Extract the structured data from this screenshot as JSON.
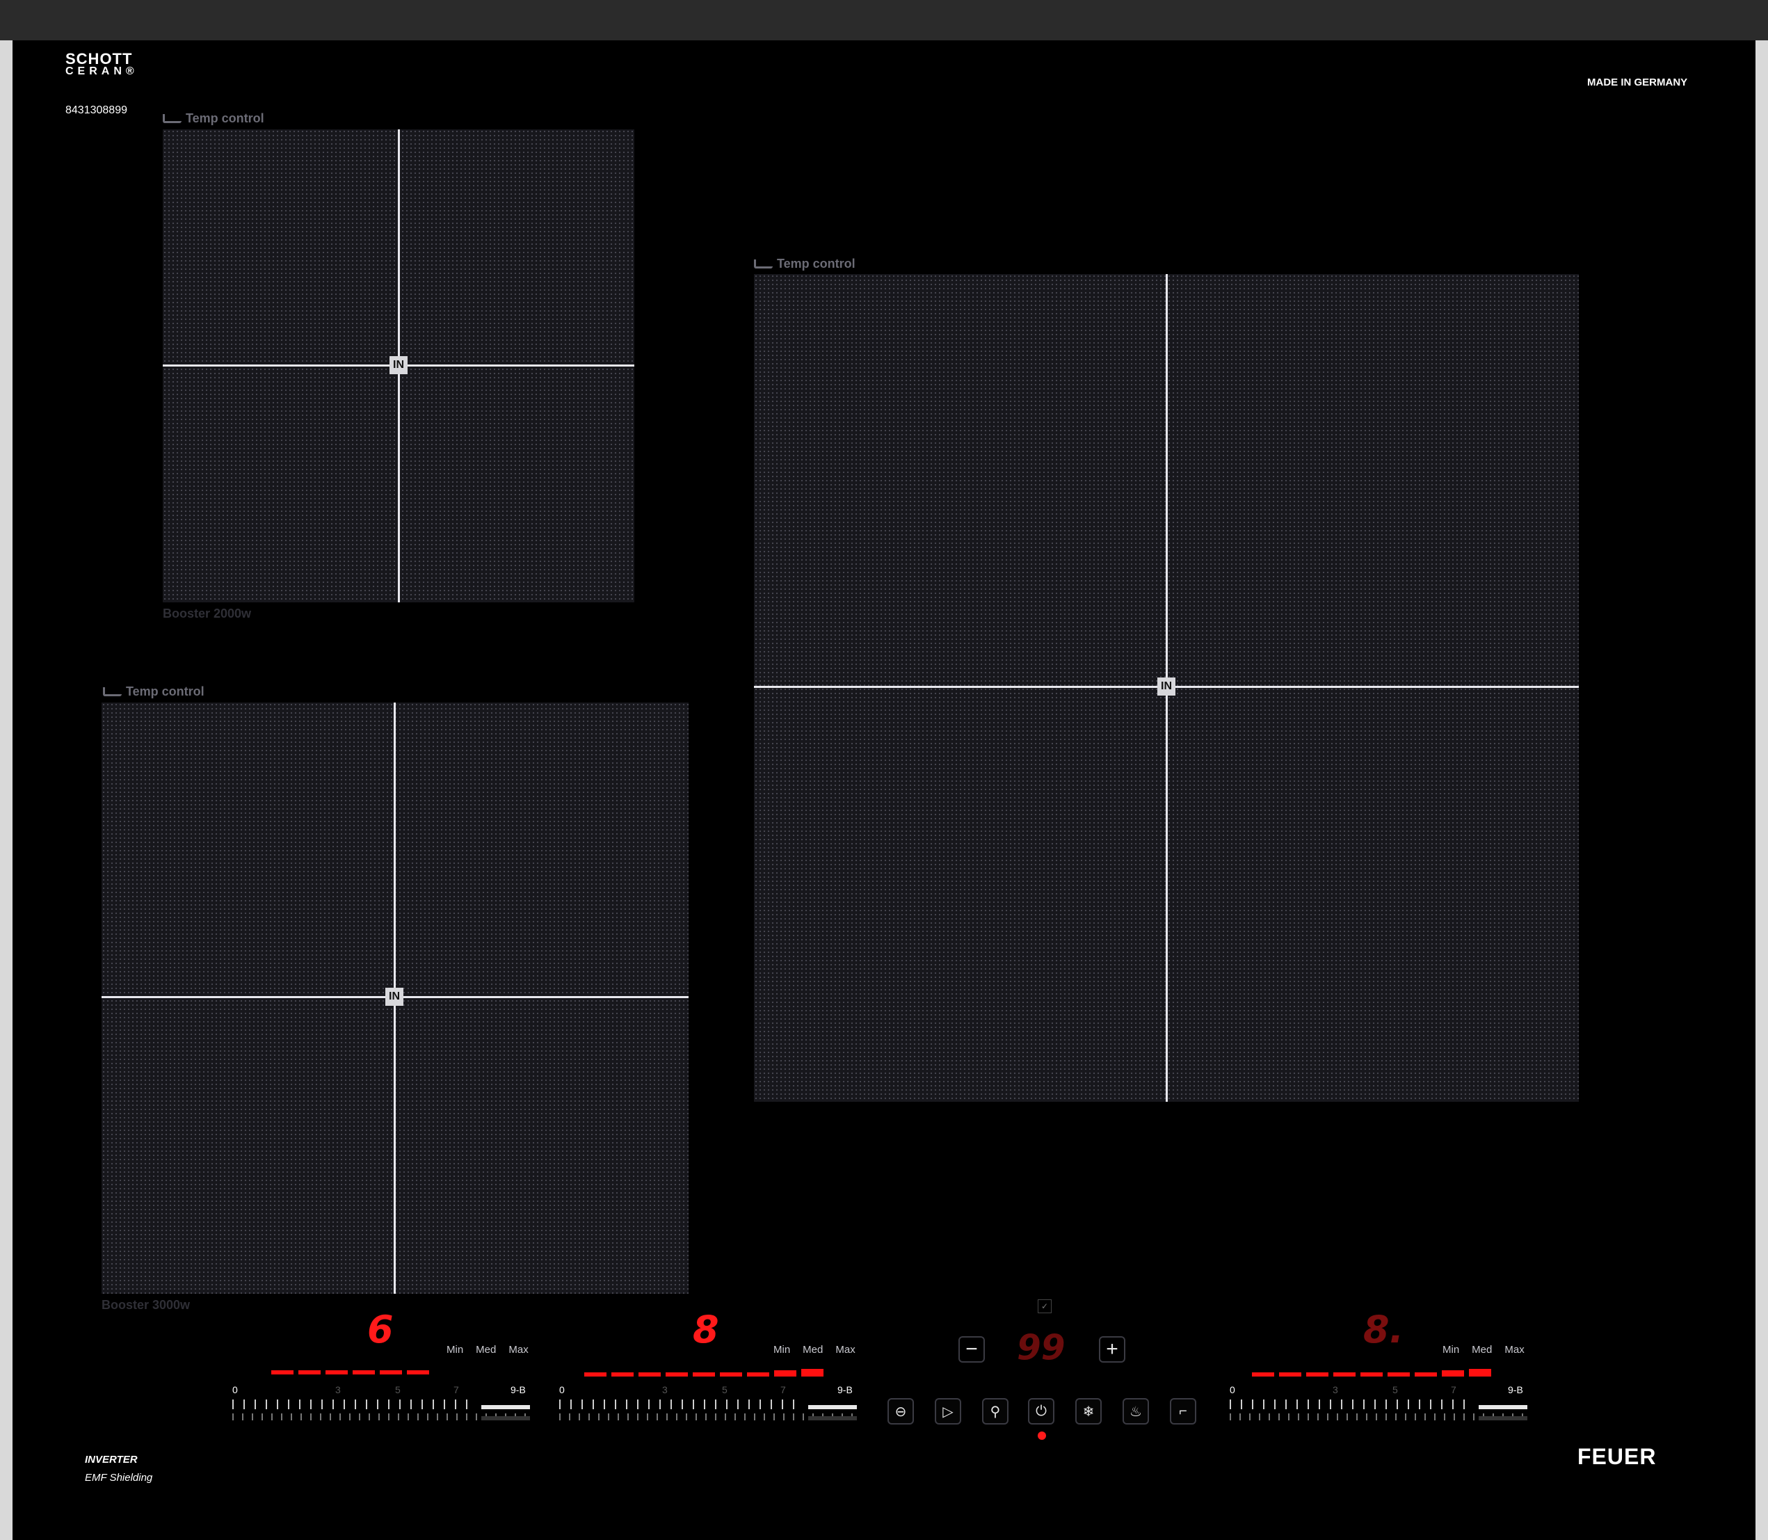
{
  "header": {
    "brand_line1": "SCHOTT",
    "brand_line2": "CERAN®",
    "serial": "8431308899",
    "origin": "MADE IN GERMANY"
  },
  "zones": [
    {
      "label": "Temp control",
      "footer": "Booster 2000w",
      "badge": "IN"
    },
    {
      "label": "Temp control",
      "footer": "",
      "badge": "IN"
    },
    {
      "label": "Temp control",
      "footer": "Booster 3000w",
      "badge": "IN"
    }
  ],
  "controls": {
    "left": {
      "level": "6",
      "min": "Min",
      "med": "Med",
      "max": "Max",
      "scale_start": "0",
      "scale_3": "3",
      "scale_5": "5",
      "scale_7": "7",
      "scale_end": "9-B",
      "lit_bars": 6,
      "total_bars": 6
    },
    "mid": {
      "level": "8",
      "min": "Min",
      "med": "Med",
      "max": "Max",
      "scale_start": "0",
      "scale_3": "3",
      "scale_5": "5",
      "scale_7": "7",
      "scale_end": "9-B",
      "lit_bars": 9,
      "total_bars": 9
    },
    "right": {
      "level": "8.",
      "min": "Min",
      "med": "Med",
      "max": "Max",
      "scale_start": "0",
      "scale_3": "3",
      "scale_5": "5",
      "scale_7": "7",
      "scale_end": "9-B",
      "lit_bars": 9,
      "total_bars": 9
    },
    "timer": {
      "value": "99",
      "minus": "−",
      "plus": "+"
    }
  },
  "icons": [
    "pause-icon",
    "play-icon",
    "tool-icon",
    "power-icon",
    "snowflake-icon",
    "heat-icon",
    "pan-icon"
  ],
  "footer": {
    "inverter": "INVERTER",
    "emf": "EMF Shielding",
    "brand": "FEUER"
  },
  "colors": {
    "accent": "#ff1a1a",
    "background": "#000000"
  }
}
